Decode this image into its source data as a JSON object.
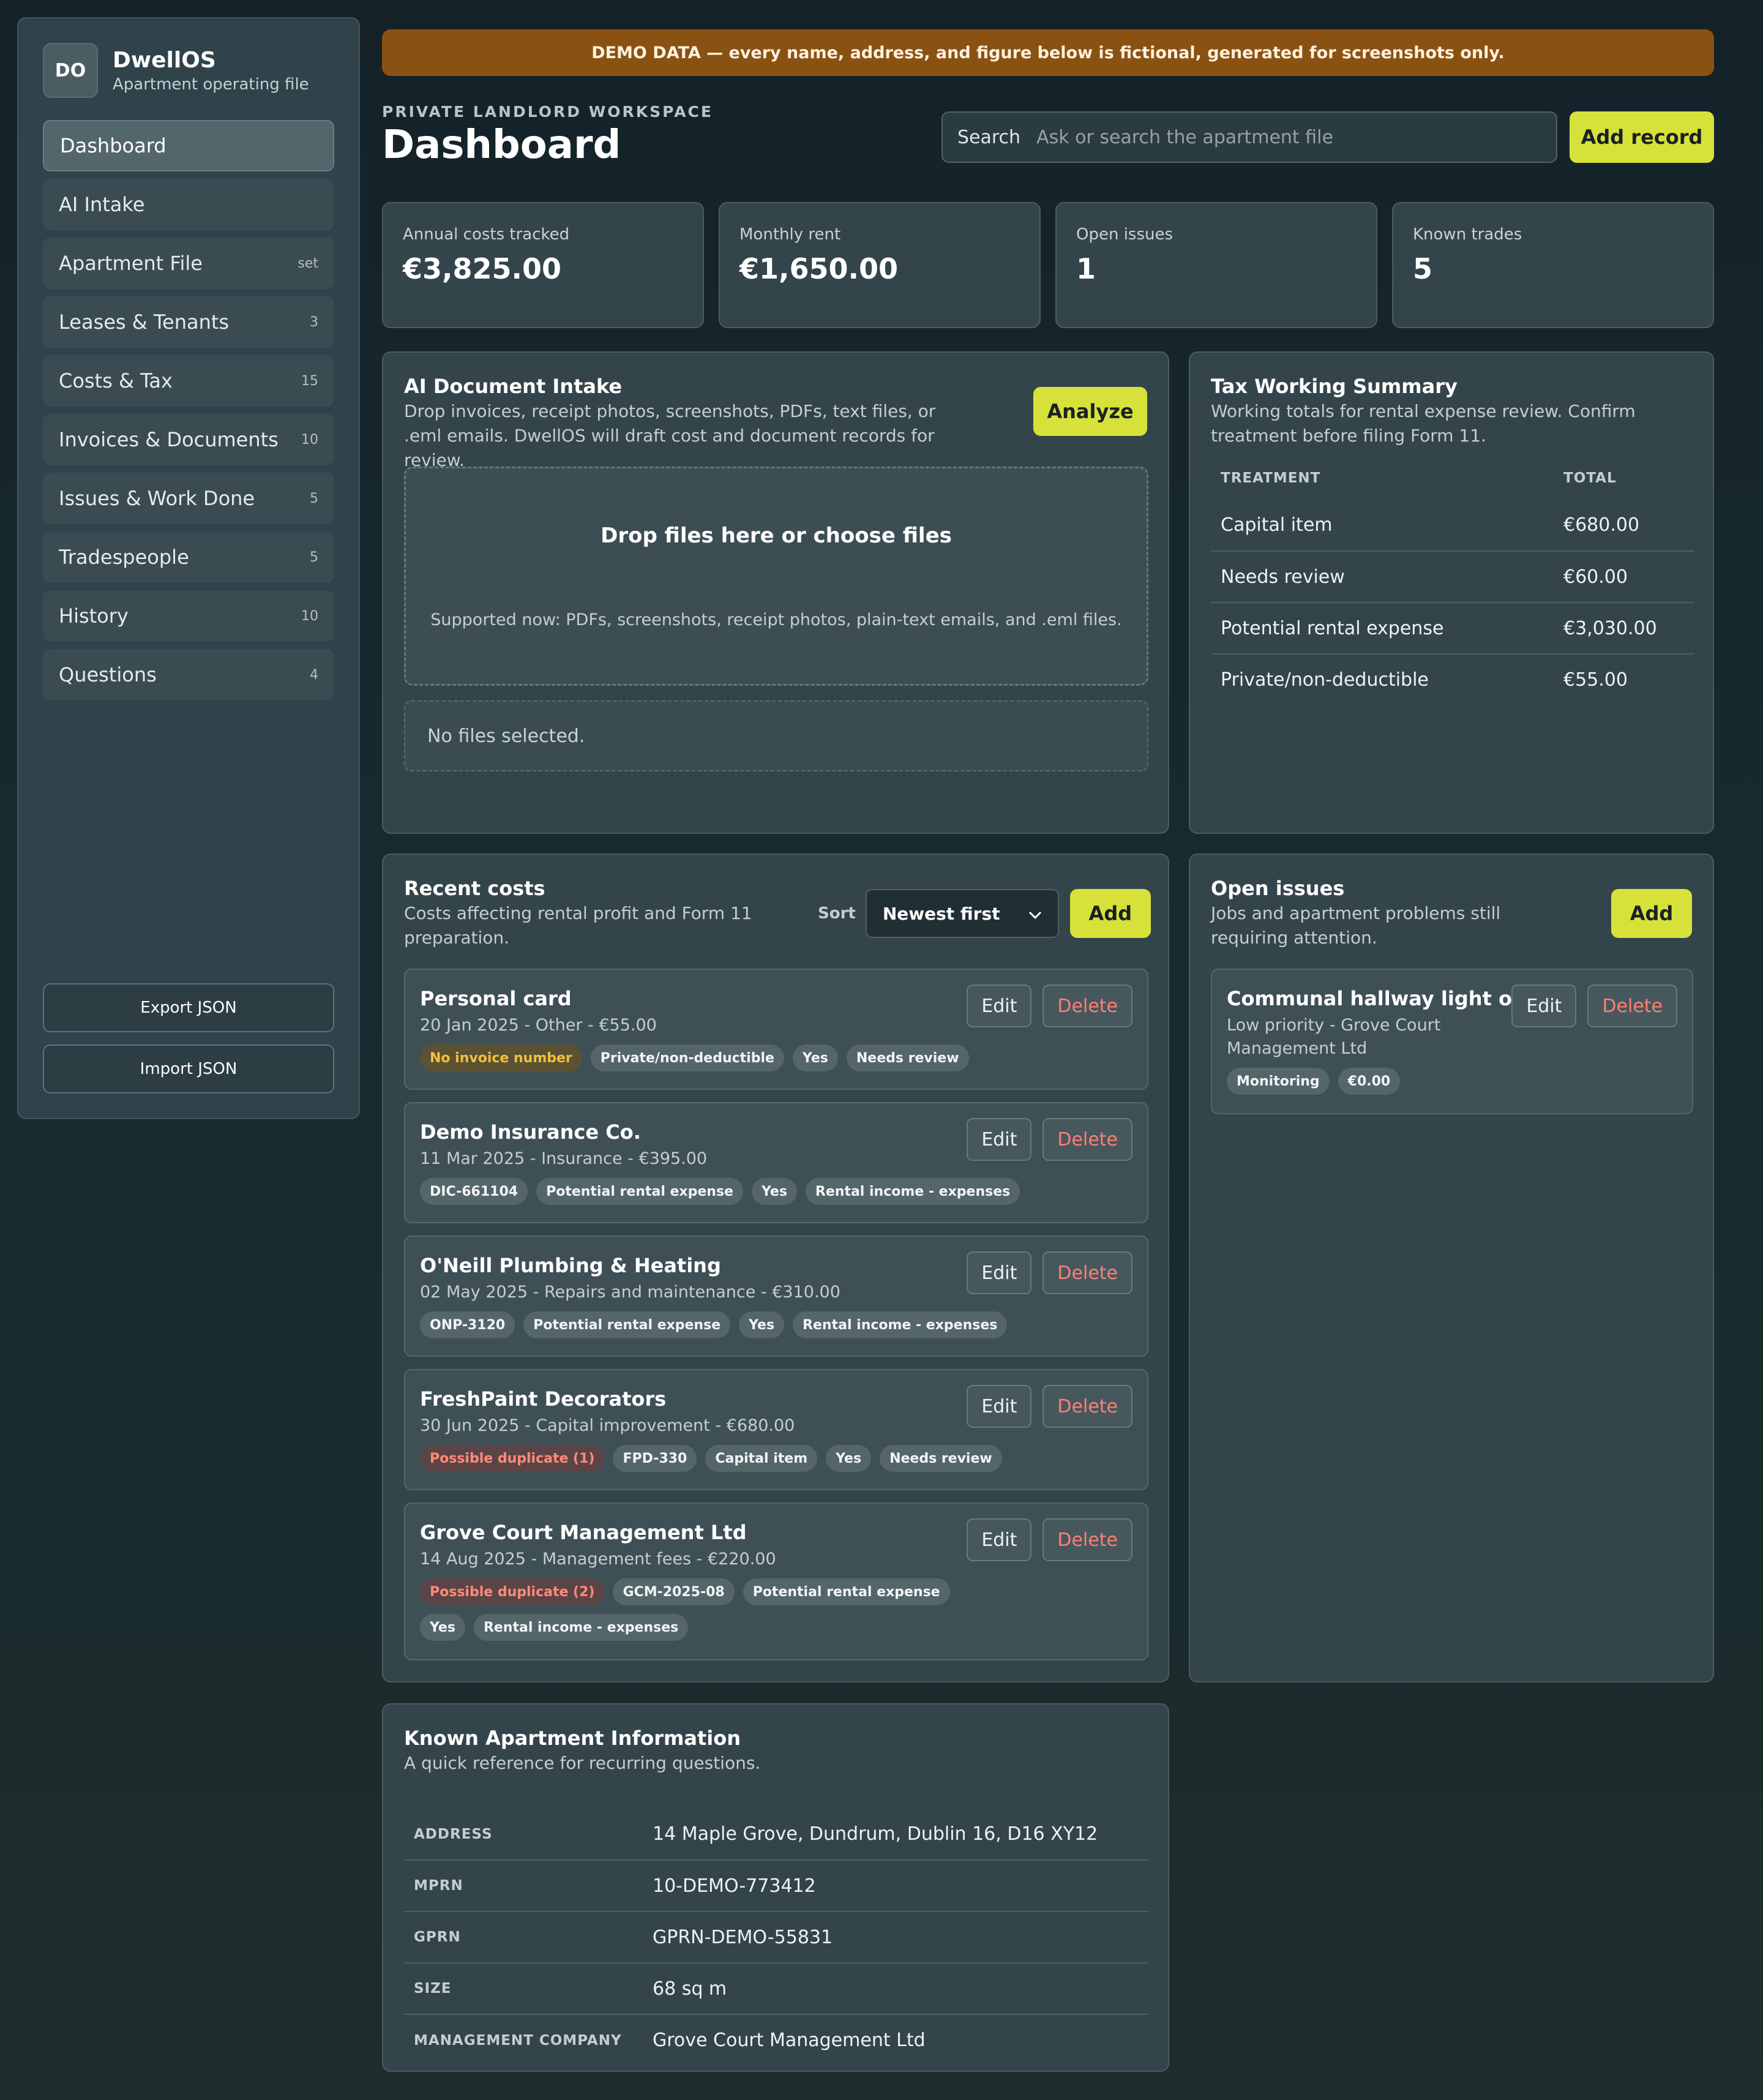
{
  "brand": {
    "logo": "DO",
    "title": "DwellOS",
    "subtitle": "Apartment operating file"
  },
  "nav": [
    {
      "label": "Dashboard",
      "count": ""
    },
    {
      "label": "AI Intake",
      "count": ""
    },
    {
      "label": "Apartment File",
      "count": "set"
    },
    {
      "label": "Leases & Tenants",
      "count": "3"
    },
    {
      "label": "Costs & Tax",
      "count": "15"
    },
    {
      "label": "Invoices & Documents",
      "count": "10"
    },
    {
      "label": "Issues & Work Done",
      "count": "5"
    },
    {
      "label": "Tradespeople",
      "count": "5"
    },
    {
      "label": "History",
      "count": "10"
    },
    {
      "label": "Questions",
      "count": "4"
    }
  ],
  "sidebar_actions": {
    "export": "Export JSON",
    "import": "Import JSON"
  },
  "banner": "DEMO DATA — every name, address, and figure below is fictional, generated for screenshots only.",
  "header": {
    "kicker": "PRIVATE LANDLORD WORKSPACE",
    "title": "Dashboard",
    "search_label": "Search",
    "search_placeholder": "Ask or search the apartment file",
    "add_record": "Add record"
  },
  "stats": [
    {
      "label": "Annual costs tracked",
      "value": "€3,825.00"
    },
    {
      "label": "Monthly rent",
      "value": "€1,650.00"
    },
    {
      "label": "Open issues",
      "value": "1"
    },
    {
      "label": "Known trades",
      "value": "5"
    }
  ],
  "intake": {
    "title": "AI Document Intake",
    "desc": "Drop invoices, receipt photos, screenshots, PDFs, text files, or .eml emails. DwellOS will draft cost and document records for review.",
    "analyze": "Analyze",
    "drop_title": "Drop files here or choose files",
    "drop_sub": "Supported now: PDFs, screenshots, receipt photos, plain-text emails, and .eml files.",
    "no_files": "No files selected."
  },
  "tax": {
    "title": "Tax Working Summary",
    "desc": "Working totals for rental expense review. Confirm treatment before filing Form 11.",
    "col_treatment": "TREATMENT",
    "col_total": "TOTAL",
    "rows": [
      {
        "treatment": "Capital item",
        "total": "€680.00"
      },
      {
        "treatment": "Needs review",
        "total": "€60.00"
      },
      {
        "treatment": "Potential rental expense",
        "total": "€3,030.00"
      },
      {
        "treatment": "Private/non-deductible",
        "total": "€55.00"
      }
    ]
  },
  "costs": {
    "title": "Recent costs",
    "desc": "Costs affecting rental profit and Form 11 preparation.",
    "sort_label": "Sort",
    "sort_value": "Newest first",
    "add": "Add",
    "edit": "Edit",
    "delete": "Delete",
    "items": [
      {
        "title": "Personal card",
        "meta": "20 Jan 2025 - Other - €55.00",
        "tags": [
          {
            "t": "No invoice number",
            "k": "warn"
          },
          {
            "t": "Private/non-deductible",
            "k": ""
          },
          {
            "t": "Yes",
            "k": ""
          },
          {
            "t": "Needs review",
            "k": ""
          }
        ]
      },
      {
        "title": "Demo Insurance Co.",
        "meta": "11 Mar 2025 - Insurance - €395.00",
        "tags": [
          {
            "t": "DIC-661104",
            "k": ""
          },
          {
            "t": "Potential rental expense",
            "k": ""
          },
          {
            "t": "Yes",
            "k": ""
          },
          {
            "t": "Rental income - expenses",
            "k": ""
          }
        ]
      },
      {
        "title": "O'Neill Plumbing & Heating",
        "meta": "02 May 2025 - Repairs and maintenance - €310.00",
        "tags": [
          {
            "t": "ONP-3120",
            "k": ""
          },
          {
            "t": "Potential rental expense",
            "k": ""
          },
          {
            "t": "Yes",
            "k": ""
          },
          {
            "t": "Rental income - expenses",
            "k": ""
          }
        ]
      },
      {
        "title": "FreshPaint Decorators",
        "meta": "30 Jun 2025 - Capital improvement - €680.00",
        "tags": [
          {
            "t": "Possible duplicate (1)",
            "k": "danger"
          },
          {
            "t": "FPD-330",
            "k": ""
          },
          {
            "t": "Capital item",
            "k": ""
          },
          {
            "t": "Yes",
            "k": ""
          },
          {
            "t": "Needs review",
            "k": ""
          }
        ]
      },
      {
        "title": "Grove Court Management Ltd",
        "meta": "14 Aug 2025 - Management fees - €220.00",
        "tags": [
          {
            "t": "Possible duplicate (2)",
            "k": "danger"
          },
          {
            "t": "GCM-2025-08",
            "k": ""
          },
          {
            "t": "Potential rental expense",
            "k": ""
          },
          {
            "t": "Yes",
            "k": ""
          },
          {
            "t": "Rental income - expenses",
            "k": ""
          }
        ]
      }
    ]
  },
  "issues": {
    "title": "Open issues",
    "desc": "Jobs and apartment problems still requiring attention.",
    "add": "Add",
    "items": [
      {
        "title": "Communal hallway light out",
        "meta": "Low priority - Grove Court Management Ltd",
        "tags": [
          {
            "t": "Monitoring",
            "k": ""
          },
          {
            "t": "€0.00",
            "k": ""
          }
        ]
      }
    ]
  },
  "info": {
    "title": "Known Apartment Information",
    "desc": "A quick reference for recurring questions.",
    "rows": [
      {
        "key": "ADDRESS",
        "value": "14 Maple Grove, Dundrum, Dublin 16, D16 XY12"
      },
      {
        "key": "MPRN",
        "value": "10-DEMO-773412"
      },
      {
        "key": "GPRN",
        "value": "GPRN-DEMO-55831"
      },
      {
        "key": "SIZE",
        "value": "68 sq m"
      },
      {
        "key": "MANAGEMENT COMPANY",
        "value": "Grove Court Management Ltd"
      }
    ]
  },
  "icons": {
    "sort": "chevron-down-icon"
  }
}
